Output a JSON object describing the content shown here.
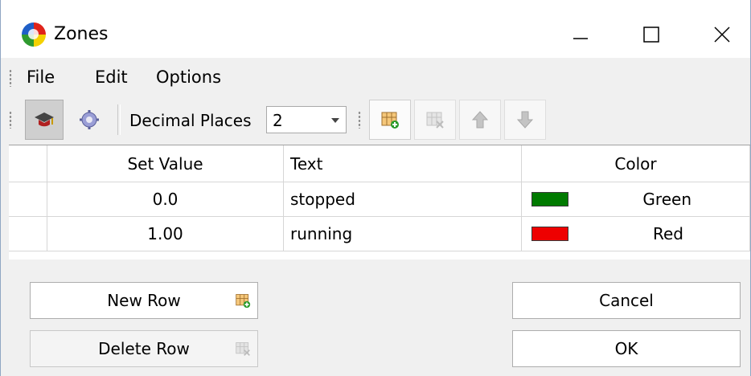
{
  "window": {
    "title": "Zones"
  },
  "menu": {
    "items": [
      "File",
      "Edit",
      "Options"
    ]
  },
  "toolbar": {
    "decimal_places_label": "Decimal Places",
    "decimal_places_value": "2"
  },
  "table": {
    "columns": [
      "Set Value",
      "Text",
      "Color"
    ],
    "rows": [
      {
        "set_value": "0.0",
        "text": "stopped",
        "color_name": "Green",
        "color_hex": "#007a00"
      },
      {
        "set_value": "1.00",
        "text": "running",
        "color_name": "Red",
        "color_hex": "#ee0000"
      }
    ]
  },
  "buttons": {
    "new_row": "New Row",
    "delete_row": "Delete Row",
    "cancel": "Cancel",
    "ok": "OK"
  }
}
